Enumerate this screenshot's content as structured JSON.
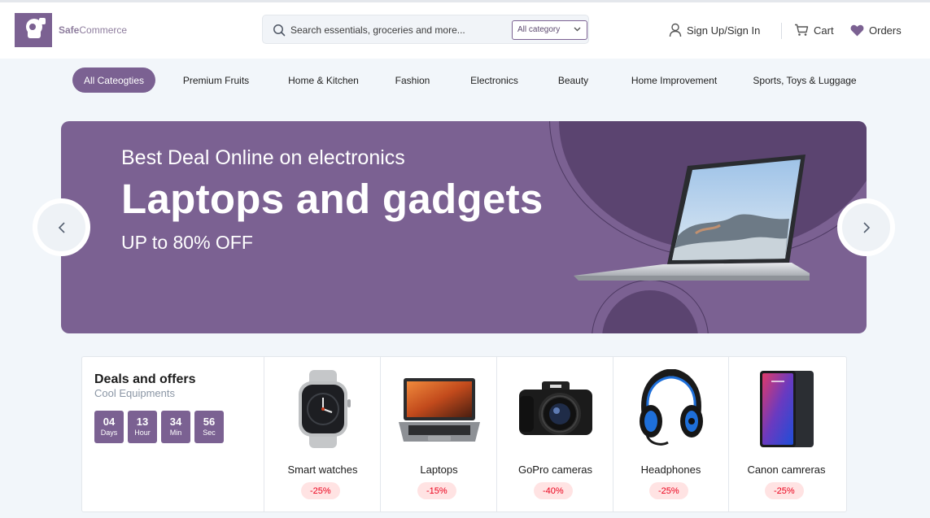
{
  "brand": {
    "name_bold": "Safe",
    "name_light": "Commerce",
    "logo_icon": "brand-logo-icon",
    "color": "#7b6192"
  },
  "search": {
    "placeholder": "Search essentials, groceries and more...",
    "category": "All category",
    "icon": "search-icon"
  },
  "nav": {
    "signin": {
      "label": "Sign Up/Sign In",
      "icon": "user-icon"
    },
    "cart": {
      "label": "Cart",
      "icon": "cart-icon"
    },
    "orders": {
      "label": "Orders",
      "icon": "heart-icon"
    }
  },
  "categories": [
    {
      "label": "All Cateogties",
      "active": true
    },
    {
      "label": "Premium Fruits"
    },
    {
      "label": "Home & Kitchen"
    },
    {
      "label": "Fashion"
    },
    {
      "label": "Electronics"
    },
    {
      "label": "Beauty"
    },
    {
      "label": "Home Improvement"
    },
    {
      "label": "Sports, Toys & Luggage"
    }
  ],
  "banner": {
    "subtitle": "Best Deal Online on electronics",
    "title": "Laptops and gadgets",
    "offer": "UP to 80% OFF"
  },
  "deals": {
    "title": "Deals and offers",
    "subtitle": "Cool Equipments",
    "timer": [
      {
        "value": "04",
        "unit": "Days"
      },
      {
        "value": "13",
        "unit": "Hour"
      },
      {
        "value": "34",
        "unit": "Min"
      },
      {
        "value": "56",
        "unit": "Sec"
      }
    ],
    "items": [
      {
        "name": "Smart watches",
        "discount": "-25%",
        "icon": "smartwatch-image"
      },
      {
        "name": "Laptops",
        "discount": "-15%",
        "icon": "laptop-image"
      },
      {
        "name": "GoPro cameras",
        "discount": "-40%",
        "icon": "camera-image"
      },
      {
        "name": "Headphones",
        "discount": "-25%",
        "icon": "headphones-image"
      },
      {
        "name": "Canon camreras",
        "discount": "-25%",
        "icon": "phone-image"
      }
    ]
  },
  "colors": {
    "accent": "#7b6192",
    "accent_dark": "#5b4470",
    "discount": "#eb001b",
    "discount_bg": "#ffe3e3"
  }
}
